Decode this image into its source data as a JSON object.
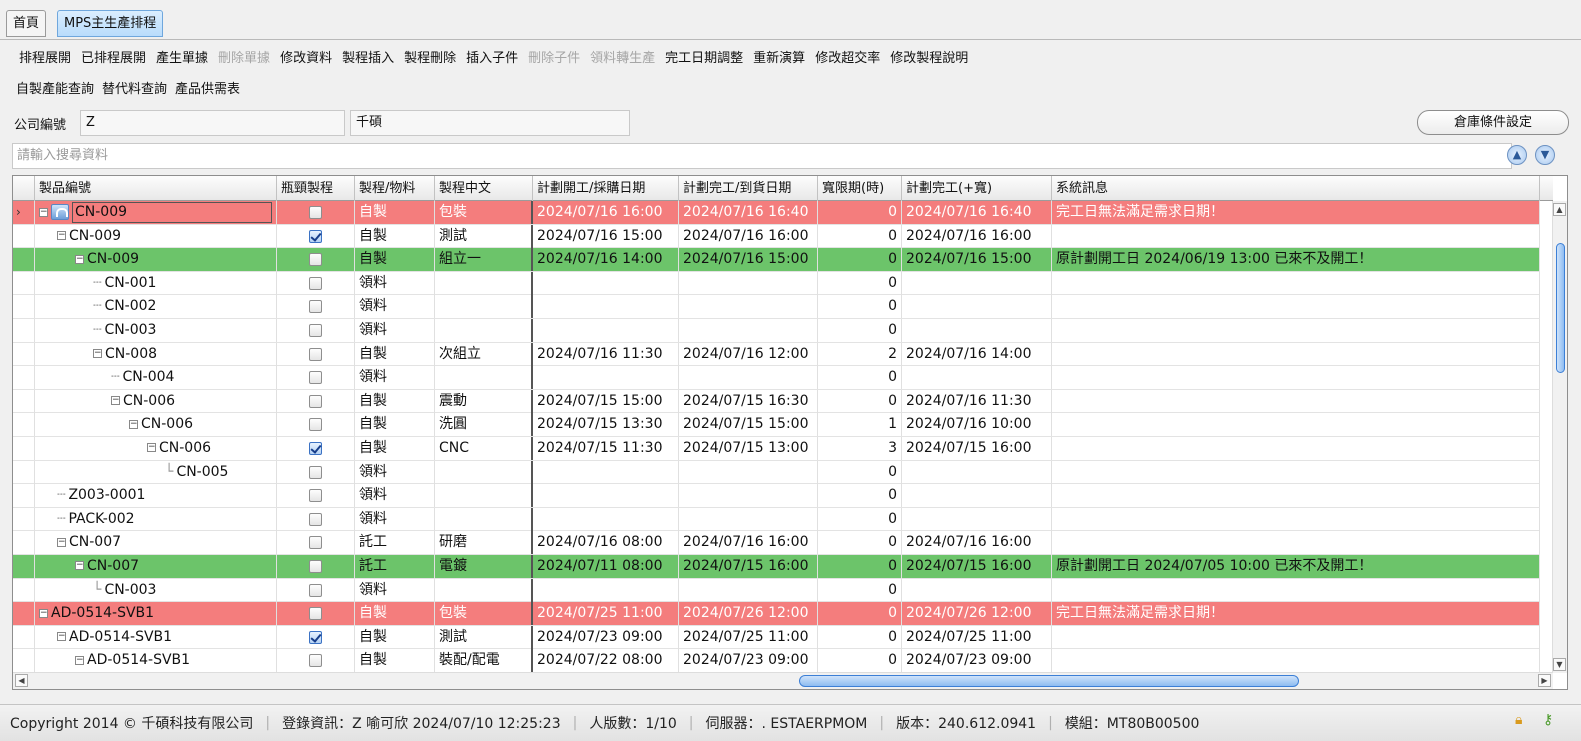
{
  "tabs": [
    {
      "label": "首頁"
    },
    {
      "label": "MPS主生產排程"
    }
  ],
  "toolbar1": [
    {
      "label": "排程展開",
      "enabled": true
    },
    {
      "label": "已排程展開",
      "enabled": true
    },
    {
      "label": "產生單據",
      "enabled": true
    },
    {
      "label": "刪除單據",
      "enabled": false
    },
    {
      "label": "修改資料",
      "enabled": true
    },
    {
      "label": "製程插入",
      "enabled": true
    },
    {
      "label": "製程刪除",
      "enabled": true
    },
    {
      "label": "插入子件",
      "enabled": true
    },
    {
      "label": "刪除子件",
      "enabled": false
    },
    {
      "label": "領料轉生產",
      "enabled": false
    },
    {
      "label": "完工日期調整",
      "enabled": true
    },
    {
      "label": "重新演算",
      "enabled": true
    },
    {
      "label": "修改超交率",
      "enabled": true
    },
    {
      "label": "修改製程說明",
      "enabled": true
    }
  ],
  "toolbar2": [
    {
      "label": "自製產能查詢"
    },
    {
      "label": "替代料查詢"
    },
    {
      "label": "產品供需表"
    }
  ],
  "company": {
    "label": "公司編號",
    "code": "Z",
    "name": "千碩"
  },
  "warehouse_button": "倉庫條件設定",
  "search": {
    "placeholder": "請輸入搜尋資料"
  },
  "columns": [
    "製品編號",
    "瓶頸製程",
    "製程/物料",
    "製程中文",
    "計劃開工/採購日期",
    "計劃完工/到貨日期",
    "寬限期(時)",
    "計劃完工(+寬)",
    "系統訊息"
  ],
  "rows": [
    {
      "name": "CN-009",
      "level": 0,
      "toggle": "minus",
      "icon": true,
      "current": true,
      "bottleneck": false,
      "type": "自製",
      "process": "包裝",
      "start": "2024/07/16 16:00",
      "finish": "2024/07/16 16:40",
      "grace": "0",
      "finish_grace": "2024/07/16 16:40",
      "message": "完工日無法滿足需求日期！",
      "color": "red"
    },
    {
      "name": "CN-009",
      "level": 1,
      "toggle": "minus",
      "bottleneck": true,
      "type": "自製",
      "process": "測試",
      "start": "2024/07/16 15:00",
      "finish": "2024/07/16 16:00",
      "grace": "0",
      "finish_grace": "2024/07/16 16:00",
      "message": "",
      "color": ""
    },
    {
      "name": "CN-009",
      "level": 2,
      "toggle": "minus",
      "bottleneck": false,
      "type": "自製",
      "process": "組立一",
      "start": "2024/07/16 14:00",
      "finish": "2024/07/16 15:00",
      "grace": "0",
      "finish_grace": "2024/07/16 15:00",
      "message": "原計劃開工日 2024/06/19 13:00 已來不及開工！",
      "color": "green"
    },
    {
      "name": "CN-001",
      "level": 3,
      "toggle": "",
      "bottleneck": false,
      "type": "領料",
      "process": "",
      "start": "",
      "finish": "",
      "grace": "0",
      "finish_grace": "",
      "message": "",
      "color": ""
    },
    {
      "name": "CN-002",
      "level": 3,
      "toggle": "",
      "bottleneck": false,
      "type": "領料",
      "process": "",
      "start": "",
      "finish": "",
      "grace": "0",
      "finish_grace": "",
      "message": "",
      "color": ""
    },
    {
      "name": "CN-003",
      "level": 3,
      "toggle": "",
      "bottleneck": false,
      "type": "領料",
      "process": "",
      "start": "",
      "finish": "",
      "grace": "0",
      "finish_grace": "",
      "message": "",
      "color": ""
    },
    {
      "name": "CN-008",
      "level": 3,
      "toggle": "minus",
      "bottleneck": false,
      "type": "自製",
      "process": "次組立",
      "start": "2024/07/16 11:30",
      "finish": "2024/07/16 12:00",
      "grace": "2",
      "finish_grace": "2024/07/16 14:00",
      "message": "",
      "color": ""
    },
    {
      "name": "CN-004",
      "level": 4,
      "toggle": "",
      "bottleneck": false,
      "type": "領料",
      "process": "",
      "start": "",
      "finish": "",
      "grace": "0",
      "finish_grace": "",
      "message": "",
      "color": ""
    },
    {
      "name": "CN-006",
      "level": 4,
      "toggle": "minus",
      "bottleneck": false,
      "type": "自製",
      "process": "震動",
      "start": "2024/07/15 15:00",
      "finish": "2024/07/15 16:30",
      "grace": "0",
      "finish_grace": "2024/07/16 11:30",
      "message": "",
      "color": ""
    },
    {
      "name": "CN-006",
      "level": 5,
      "toggle": "minus",
      "bottleneck": false,
      "type": "自製",
      "process": "洗圓",
      "start": "2024/07/15 13:30",
      "finish": "2024/07/15 15:00",
      "grace": "1",
      "finish_grace": "2024/07/16 10:00",
      "message": "",
      "color": ""
    },
    {
      "name": "CN-006",
      "level": 6,
      "toggle": "minus",
      "bottleneck": true,
      "type": "自製",
      "process": "CNC",
      "start": "2024/07/15 11:30",
      "finish": "2024/07/15 13:00",
      "grace": "3",
      "finish_grace": "2024/07/15 16:00",
      "message": "",
      "color": ""
    },
    {
      "name": "CN-005",
      "level": 7,
      "toggle": "",
      "bottleneck": false,
      "type": "領料",
      "process": "",
      "start": "",
      "finish": "",
      "grace": "0",
      "finish_grace": "",
      "message": "",
      "color": ""
    },
    {
      "name": "Z003-0001",
      "level": 1,
      "toggle": "",
      "bottleneck": false,
      "type": "領料",
      "process": "",
      "start": "",
      "finish": "",
      "grace": "0",
      "finish_grace": "",
      "message": "",
      "color": ""
    },
    {
      "name": "PACK-002",
      "level": 1,
      "toggle": "",
      "bottleneck": false,
      "type": "領料",
      "process": "",
      "start": "",
      "finish": "",
      "grace": "0",
      "finish_grace": "",
      "message": "",
      "color": ""
    },
    {
      "name": "CN-007",
      "level": 1,
      "toggle": "minus",
      "bottleneck": false,
      "type": "託工",
      "process": "研磨",
      "start": "2024/07/16 08:00",
      "finish": "2024/07/16 16:00",
      "grace": "0",
      "finish_grace": "2024/07/16 16:00",
      "message": "",
      "color": ""
    },
    {
      "name": "CN-007",
      "level": 2,
      "toggle": "minus",
      "bottleneck": false,
      "type": "託工",
      "process": "電鍍",
      "start": "2024/07/11 08:00",
      "finish": "2024/07/15 16:00",
      "grace": "0",
      "finish_grace": "2024/07/15 16:00",
      "message": "原計劃開工日 2024/07/05 10:00 已來不及開工！",
      "color": "green"
    },
    {
      "name": "CN-003",
      "level": 3,
      "toggle": "",
      "bottleneck": false,
      "type": "領料",
      "process": "",
      "start": "",
      "finish": "",
      "grace": "0",
      "finish_grace": "",
      "message": "",
      "color": ""
    },
    {
      "name": "AD-0514-SVB1",
      "level": 0,
      "toggle": "minus",
      "bottleneck": false,
      "type": "自製",
      "process": "包裝",
      "start": "2024/07/25 11:00",
      "finish": "2024/07/26 12:00",
      "grace": "0",
      "finish_grace": "2024/07/26 12:00",
      "message": "完工日無法滿足需求日期！",
      "color": "red"
    },
    {
      "name": "AD-0514-SVB1",
      "level": 1,
      "toggle": "minus",
      "bottleneck": true,
      "type": "自製",
      "process": "測試",
      "start": "2024/07/23 09:00",
      "finish": "2024/07/25 11:00",
      "grace": "0",
      "finish_grace": "2024/07/25 11:00",
      "message": "",
      "color": ""
    },
    {
      "name": "AD-0514-SVB1",
      "level": 2,
      "toggle": "minus",
      "bottleneck": false,
      "type": "自製",
      "process": "裝配/配電",
      "start": "2024/07/22 08:00",
      "finish": "2024/07/23 09:00",
      "grace": "0",
      "finish_grace": "2024/07/23 09:00",
      "message": "",
      "color": ""
    }
  ],
  "statusbar": {
    "copyright": "Copyright 2014 © 千碩科技有限公司",
    "login": "登錄資訊：Z 喻可欣 2024/07/10 12:25:23",
    "users": "人版數：1/10",
    "server": "伺服器：. ESTAERPMOM",
    "version": "版本：240.612.0941",
    "module": "模組：MT80B00500"
  },
  "icons": {
    "lock": "lock-icon",
    "key": "key-icon",
    "up": "arrow-up-icon",
    "down": "arrow-down-icon"
  }
}
